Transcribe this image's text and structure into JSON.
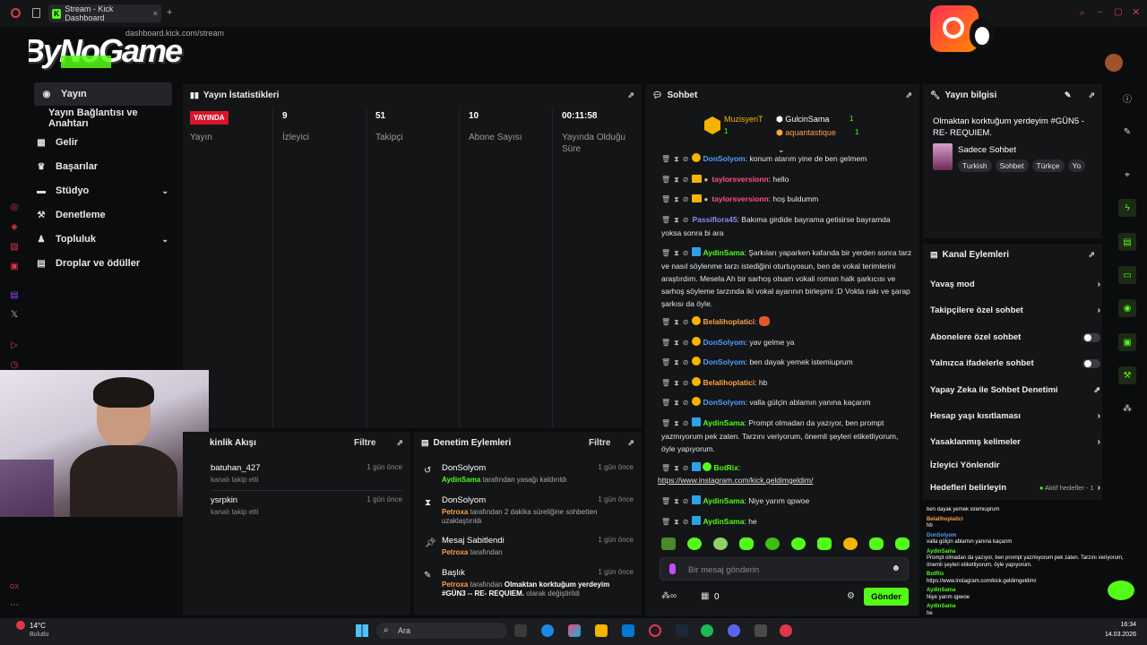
{
  "browser": {
    "tab_title": "Stream - Kick Dashboard",
    "url": "dashboard.kick.com/stream",
    "new_tab": "+"
  },
  "overlay_logo": "ByNoGame",
  "sidebar": {
    "items": [
      {
        "label": "Yayın",
        "icon": "broadcast-icon"
      },
      {
        "label": "Yayın Bağlantısı ve Anahtarı",
        "icon": ""
      },
      {
        "label": "Gelir",
        "icon": "chart-icon"
      },
      {
        "label": "Başarılar",
        "icon": "trophy-icon"
      },
      {
        "label": "Stüdyo",
        "icon": "studio-icon"
      },
      {
        "label": "Denetleme",
        "icon": "hammer-icon"
      },
      {
        "label": "Topluluk",
        "icon": "community-icon"
      },
      {
        "label": "Droplar ve ödüller",
        "icon": "drops-icon"
      }
    ]
  },
  "stats": {
    "title": "Yayın İstatistikleri",
    "live_badge": "YAYINDA",
    "live_label": "Yayın",
    "items": [
      {
        "value": "9",
        "label": "İzleyici"
      },
      {
        "value": "51",
        "label": "Takipçi"
      },
      {
        "value": "10",
        "label": "Abone Sayısı"
      },
      {
        "value": "00:11:58",
        "label": "Yayında Olduğu Süre"
      }
    ]
  },
  "chat": {
    "title": "Sohbet",
    "leaderboard": [
      {
        "name": "MuzisyenT",
        "count": "1"
      },
      {
        "name": "GulcinSama",
        "count": "1"
      },
      {
        "name": "aquantastique",
        "count": "1"
      }
    ],
    "messages": [
      {
        "user": "DonSolyom",
        "text": ": konum atarım yine de ben gelmem"
      },
      {
        "user": "taylorsversionn",
        "text": ": hello"
      },
      {
        "user": "taylorsversionn",
        "text": ": hoş buldumm"
      },
      {
        "user": "Passiflora45",
        "text": ": Bakıma girdide bayrama getisirse bayramda yoksa sonra bi ara"
      },
      {
        "user": "AydinSama",
        "text": ": Şarkıları yaparken kafanda bir yerden sonra tarz ve nasıl söylenme tarzı istediğini oturtuyosun, ben de vokal terimlerini araştırdım. Mesela Ah bir sarhoş olsam vokali roman halk şarkıcısı ve sarhoş söyleme tarzında iki vokal ayarının birleşimi :D Vokta rakı ve şarap şarkısı da öyle."
      },
      {
        "user": "Belalihoplatici",
        "text": ":"
      },
      {
        "user": "DonSolyom",
        "text": ": yav gelme ya"
      },
      {
        "user": "DonSolyom",
        "text": ": ben dayak yemek istemiuprum"
      },
      {
        "user": "Belalihoplatici",
        "text": ": hb"
      },
      {
        "user": "DonSolyom",
        "text": ": valla gülçin ablamın yanına kaçarım"
      },
      {
        "user": "AydinSama",
        "text": ": Prompt olmadan da yazıyor, ben prompt yazmıyorum pek zaten. Tarzını veriyorum, önemli şeyleri etiketliyorum, öyle yapıyorum."
      },
      {
        "user": "BotRix",
        "text": ":"
      },
      {
        "link": "https://www.instagram.com/kick.geldimgeldim/"
      },
      {
        "user": "AydinSama",
        "text": ": Niye yarım qpwoe"
      },
      {
        "user": "AydinSama",
        "text": ": he"
      }
    ],
    "input_placeholder": "Bir mesaj gönderin",
    "points": "0",
    "send_label": "Gönder"
  },
  "stream_info": {
    "title": "Yayın bilgisi",
    "stream_title": "Olmaktan korktuğum yerdeyim #GÜN5 - RE- REQUIEM.",
    "category": "Sadece Sohbet",
    "tags": [
      "Turkish",
      "Sohbet",
      "Türkçe",
      "Yo"
    ]
  },
  "channel_actions": {
    "title": "Kanal Eylemleri",
    "items": [
      {
        "label": "Yavaş mod",
        "control": "chevron"
      },
      {
        "label": "Takipçilere özel sohbet",
        "control": "chevron"
      },
      {
        "label": "Abonelere özel sohbet",
        "control": "toggle"
      },
      {
        "label": "Yalnızca ifadelerle sohbet",
        "control": "toggle"
      },
      {
        "label": "Yapay Zeka ile Sohbet Denetimi",
        "control": "external"
      },
      {
        "label": "Hesap yaşı kısıtlaması",
        "control": "chevron"
      },
      {
        "label": "Yasaklanmış kelimeler",
        "control": "chevron"
      },
      {
        "label": "İzleyici Yönlendir",
        "control": "none"
      },
      {
        "label": "Hedefleri belirleyin",
        "control": "chevron"
      }
    ],
    "goals_status": "Aktif hedefler - 1"
  },
  "activity": {
    "title": "kinlik Akışı",
    "filter": "Filtre",
    "items": [
      {
        "user": "batuhan_427",
        "desc": "kanalı takip etti",
        "time": "1 gün önce"
      },
      {
        "user": "ysrpkin",
        "desc": "kanalı takip etti",
        "time": "1 gün önce"
      }
    ]
  },
  "moderation": {
    "title": "Denetim Eylemleri",
    "filter": "Filtre",
    "items": [
      {
        "title": "DonSolyom",
        "actor": "AydinSama",
        "desc": "tarafından yasağı kaldırıldı",
        "time": "1 gün önce"
      },
      {
        "title": "DonSolyom",
        "actor": "Petroxa",
        "desc": "tarafından 2 dakika süreliğine sohbetten uzaklaştırıldı",
        "time": "1 gün önce"
      },
      {
        "title": "Mesaj Sabitlendi",
        "actor": "Petroxa",
        "desc": "tarafından",
        "time": "1 gün önce"
      },
      {
        "title": "Başlık",
        "actor": "Petroxa",
        "desc": "tarafından",
        "desc_bold": "Olmaktan korktuğum yerdeyim #GÜN3 -- RE- REQUIEM.",
        "desc_tail": "olarak değiştirildi",
        "time": "1 gün önce"
      }
    ]
  },
  "overlay_chat": [
    {
      "user": "",
      "text": "ben dayak yemek istemiuprum"
    },
    {
      "user": "Belalihoplatici",
      "text": "hb"
    },
    {
      "user": "DonSolyom",
      "text": "valla gülçin ablamın yanına kaçarım"
    },
    {
      "user": "AydinSama",
      "text": "Prompt olmadan da yazıyor, ben prompt yazmıyorum pek zaten. Tarzını veriyorum, önemli şeyleri etiketliyorum, öyle yapıyorum."
    },
    {
      "user": "BotRix",
      "text": "https://www.instagram.com/kick.geldimgeldim/"
    },
    {
      "user": "AydinSama",
      "text": "Niye yarım qpwoe"
    },
    {
      "user": "AydinSama",
      "text": "he"
    }
  ],
  "taskbar": {
    "weather_temp": "14°C",
    "weather_desc": "Bulutlu",
    "search": "Ara",
    "time": "16:34",
    "date": "14.03.2026"
  },
  "colors": {
    "accent": "#53fc18",
    "live": "#d9152b",
    "bg": "#0b0c0d",
    "panel": "#141517"
  }
}
